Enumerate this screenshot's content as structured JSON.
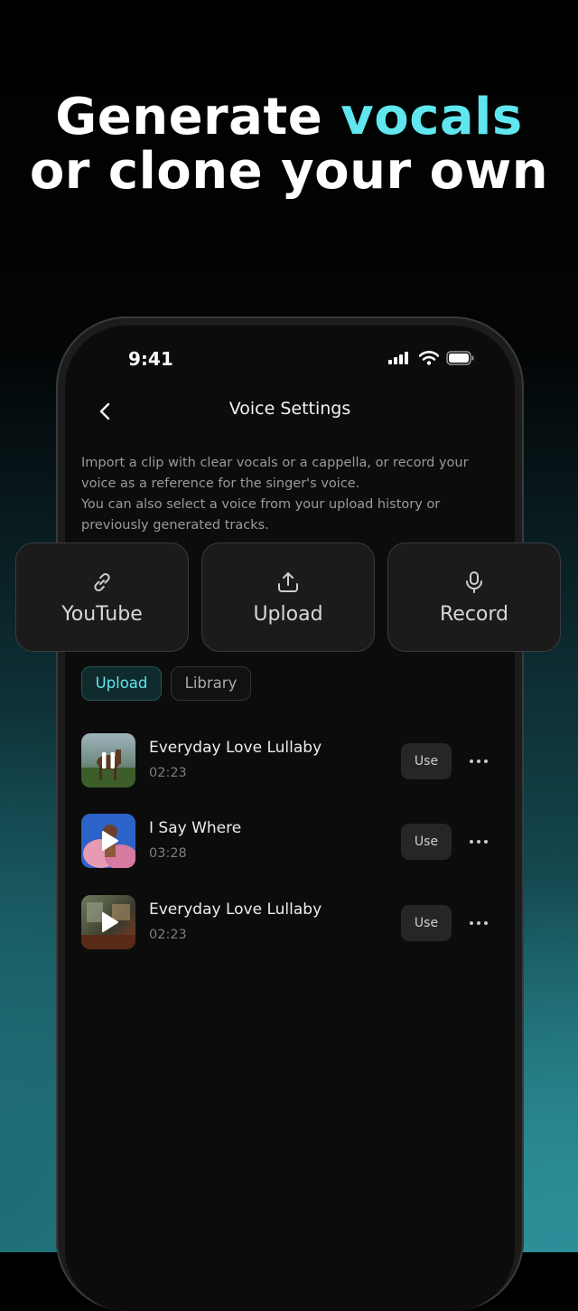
{
  "headline": {
    "line1_plain": "Generate ",
    "line1_accent": "vocals",
    "line2": "or clone your own"
  },
  "status_bar": {
    "time": "9:41"
  },
  "nav": {
    "title": "Voice Settings"
  },
  "description": {
    "line1": "Import a clip with clear vocals or a cappella, or record your voice as a reference for the singer's voice.",
    "line2": "You can also select a voice from your upload history or previously generated tracks."
  },
  "options": [
    {
      "label": "YouTube",
      "icon": "link-icon"
    },
    {
      "label": "Upload",
      "icon": "upload-icon"
    },
    {
      "label": "Record",
      "icon": "microphone-icon"
    }
  ],
  "tabs": [
    {
      "label": "Upload",
      "active": true
    },
    {
      "label": "Library",
      "active": false
    }
  ],
  "tracks": [
    {
      "title": "Everyday Love Lullaby",
      "duration": "02:23",
      "state": "playing",
      "use_label": "Use"
    },
    {
      "title": "I Say Where",
      "duration": "03:28",
      "state": "paused",
      "use_label": "Use"
    },
    {
      "title": "Everyday Love Lullaby",
      "duration": "02:23",
      "state": "paused",
      "use_label": "Use"
    }
  ],
  "colors": {
    "accent": "#5fe6ee",
    "screen_bg": "#0c0c0c",
    "card_bg": "#1b1b1c"
  }
}
